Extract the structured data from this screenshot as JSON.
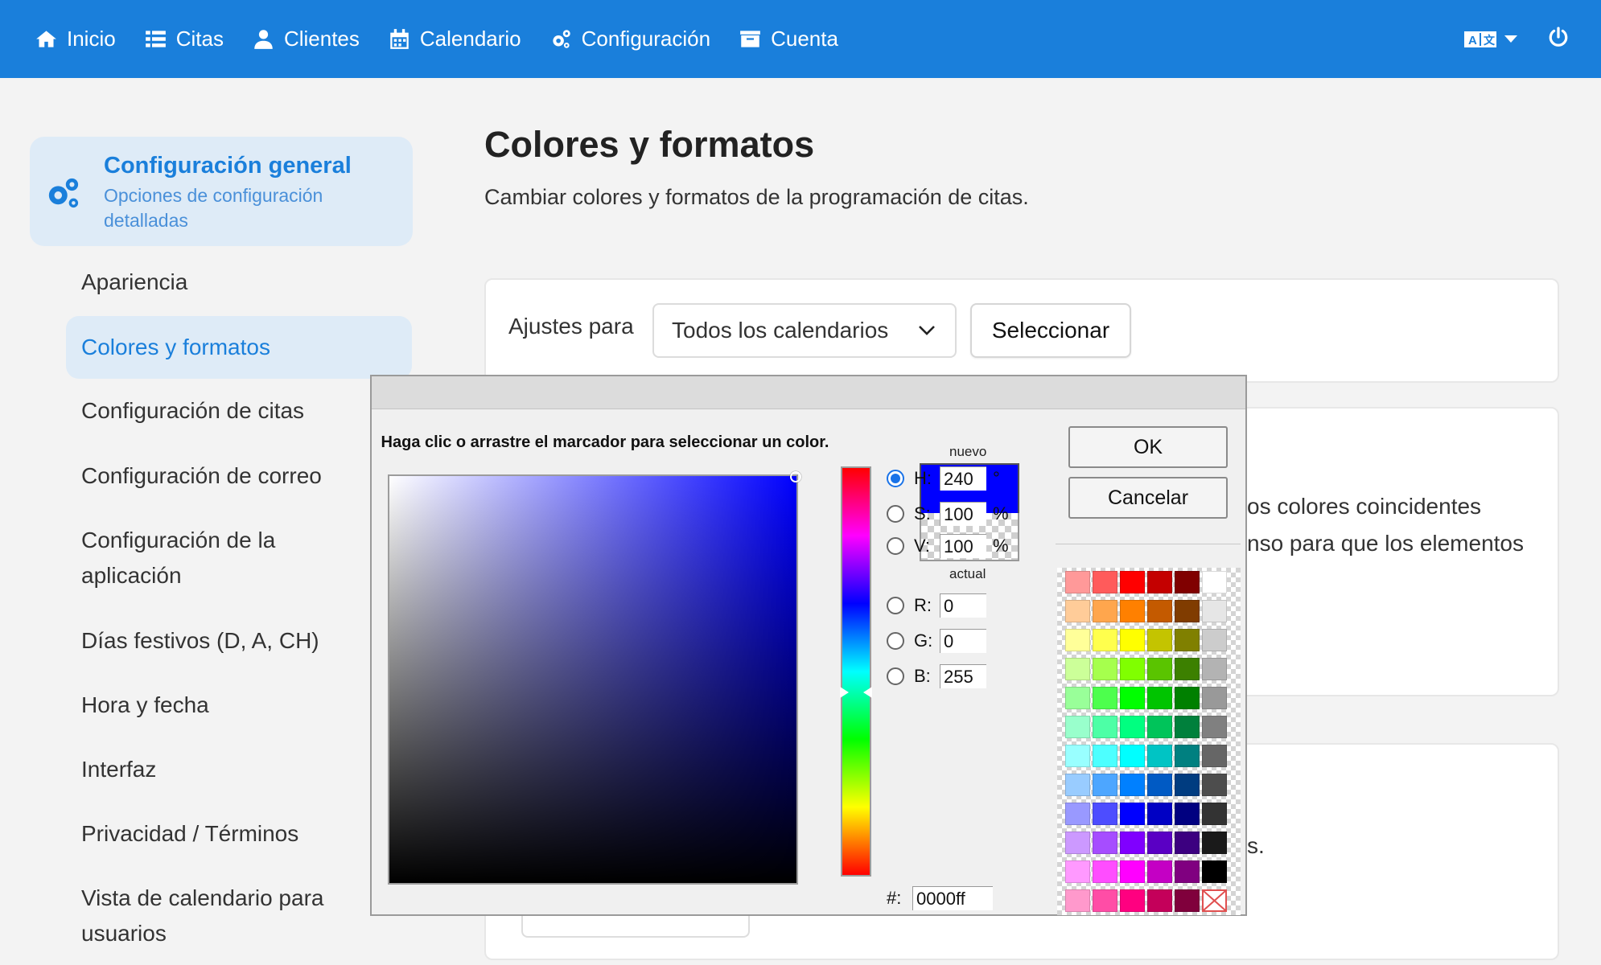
{
  "nav": {
    "items": [
      {
        "label": "Inicio",
        "icon": "home-icon"
      },
      {
        "label": "Citas",
        "icon": "list-icon"
      },
      {
        "label": "Clientes",
        "icon": "user-icon"
      },
      {
        "label": "Calendario",
        "icon": "calendar-icon"
      },
      {
        "label": "Configuración",
        "icon": "gears-icon"
      },
      {
        "label": "Cuenta",
        "icon": "inbox-icon"
      }
    ],
    "lang_icon": "language-icon",
    "power_icon": "power-icon"
  },
  "sidebar": {
    "general_title": "Configuración general",
    "general_subtitle": "Opciones de configuración detalladas",
    "items": [
      "Apariencia",
      "Colores y formatos",
      "Configuración de citas",
      "Configuración de correo",
      "Configuración de la aplicación",
      "Días festivos (D, A, CH)",
      "Hora y fecha",
      "Interfaz",
      "Privacidad / Términos",
      "Vista de calendario para usuarios"
    ],
    "active_index": 1
  },
  "main": {
    "title": "Colores y formatos",
    "description": "Cambiar colores y formatos de la programación de citas.",
    "settings_label": "Ajustes para",
    "calendar_select": "Todos los calendarios",
    "select_button": "Seleccionar",
    "partial_text_1": "os colores coincidentes",
    "partial_text_2": "nso para que los elementos",
    "partial_text_3": "s."
  },
  "picker": {
    "instruction": "Haga clic o arrastre el marcador para seleccionar un color.",
    "new_label": "nuevo",
    "current_label": "actual",
    "new_color": "#0000ff",
    "fields": [
      {
        "key": "H",
        "label": "H:",
        "value": "240",
        "unit": "°",
        "checked": true
      },
      {
        "key": "S",
        "label": "S:",
        "value": "100",
        "unit": "%",
        "checked": false
      },
      {
        "key": "V",
        "label": "V:",
        "value": "100",
        "unit": "%",
        "checked": false
      },
      {
        "key": "R",
        "label": "R:",
        "value": "0",
        "unit": "",
        "checked": false
      },
      {
        "key": "G",
        "label": "G:",
        "value": "0",
        "unit": "",
        "checked": false
      },
      {
        "key": "B",
        "label": "B:",
        "value": "255",
        "unit": "",
        "checked": false
      }
    ],
    "hex_label": "#:",
    "hex_value": "0000ff",
    "ok": "OK",
    "cancel": "Cancelar",
    "palette": [
      [
        "#ff9999",
        "#ff5b5b",
        "#ff0000",
        "#c40000",
        "#800000",
        "#ffffff"
      ],
      [
        "#ffcc99",
        "#ffa64d",
        "#ff8000",
        "#c45a00",
        "#803c00",
        "#e6e6e6"
      ],
      [
        "#ffff99",
        "#ffff4d",
        "#ffff00",
        "#c4c400",
        "#808000",
        "#cccccc"
      ],
      [
        "#ccff99",
        "#a6ff4d",
        "#80ff00",
        "#5ac400",
        "#3c8000",
        "#b3b3b3"
      ],
      [
        "#99ff99",
        "#4dff4d",
        "#00ff00",
        "#00c400",
        "#008000",
        "#999999"
      ],
      [
        "#99ffcc",
        "#4dffa6",
        "#00ff80",
        "#00c45a",
        "#00803c",
        "#808080"
      ],
      [
        "#99ffff",
        "#4dffff",
        "#00ffff",
        "#00c4c4",
        "#008080",
        "#666666"
      ],
      [
        "#99ccff",
        "#4da6ff",
        "#0080ff",
        "#005ac4",
        "#003c80",
        "#4d4d4d"
      ],
      [
        "#9999ff",
        "#4d4dff",
        "#0000ff",
        "#0000c4",
        "#000080",
        "#333333"
      ],
      [
        "#cc99ff",
        "#a64dff",
        "#8000ff",
        "#5a00c4",
        "#3c0080",
        "#1a1a1a"
      ],
      [
        "#ff99ff",
        "#ff4dff",
        "#ff00ff",
        "#c400c4",
        "#800080",
        "#000000"
      ],
      [
        "#ff99cc",
        "#ff4da6",
        "#ff0080",
        "#c4005a",
        "#80003c",
        "none"
      ]
    ]
  }
}
